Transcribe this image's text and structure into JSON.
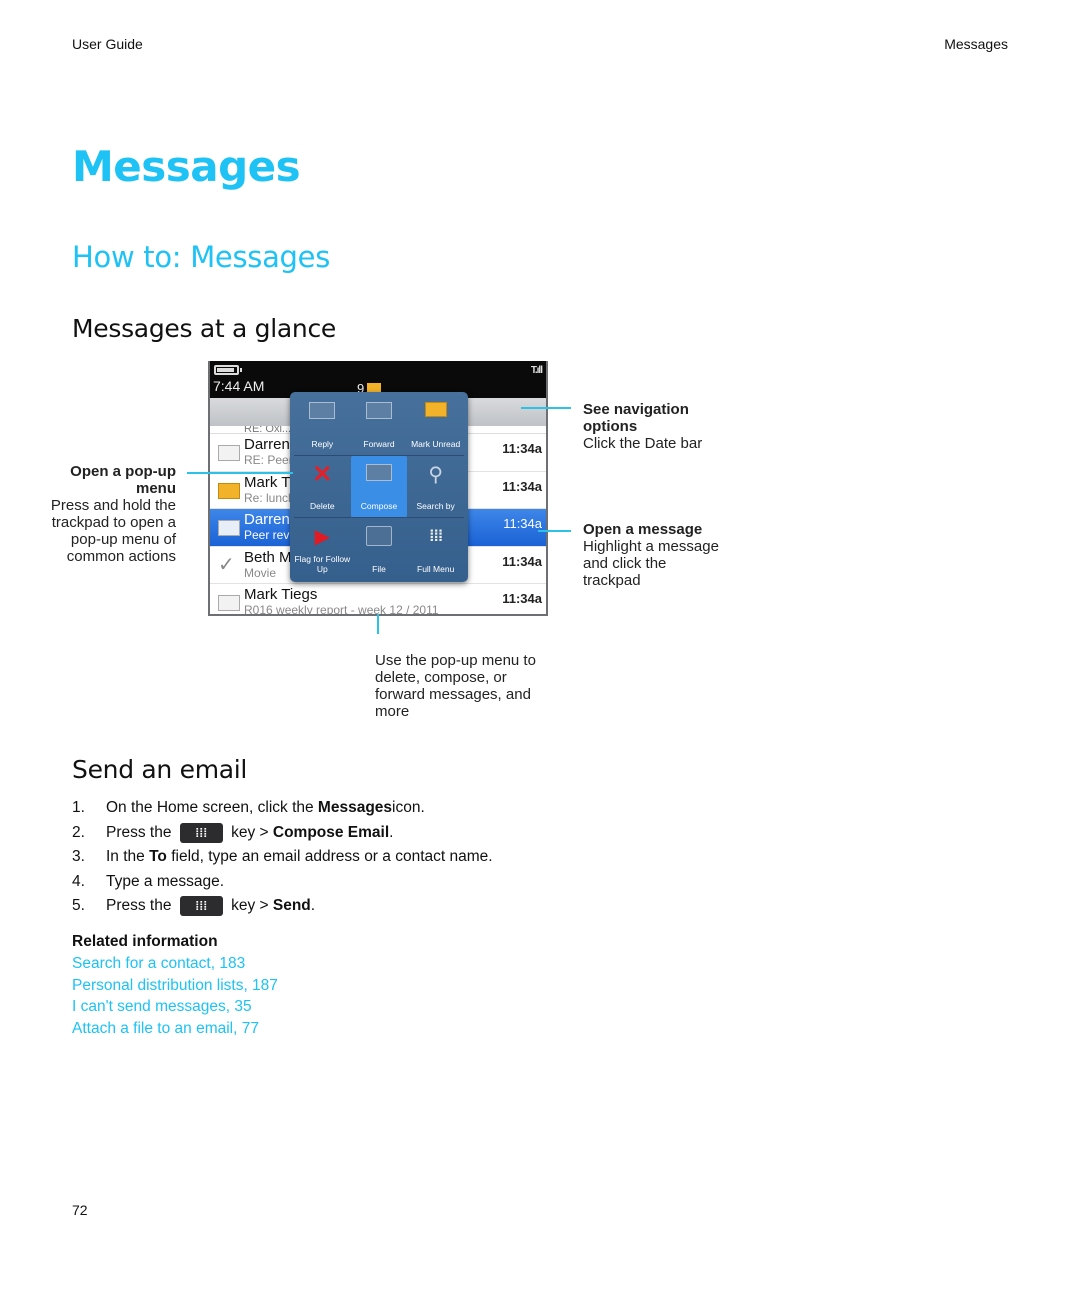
{
  "header": {
    "left": "User Guide",
    "right": "Messages"
  },
  "title": "Messages",
  "subtitle": "How to: Messages",
  "section_glance": "Messages at a glance",
  "phone": {
    "clock": "7:44 AM",
    "message_count": "9",
    "signal": "T.ıll",
    "partial_row_text": "RE: Oxi...                     LUD Ma...",
    "rows": [
      {
        "name": "Darren",
        "subject": "RE: Peer",
        "time": "11:34a",
        "icon": "envelope-read"
      },
      {
        "name": "Mark T",
        "subject": "Re: lunch",
        "time": "11:34a",
        "icon": "envelope-unread"
      },
      {
        "name": "Darren",
        "subject": "Peer review",
        "time": "11:34a",
        "icon": "envelope-attachment",
        "selected": true
      },
      {
        "name": "Beth M",
        "subject": "Movie",
        "time": "11:34a",
        "icon": "checkmark"
      },
      {
        "name": "Mark Tiegs",
        "subject": "R016 weekly report - week 12 / 2011",
        "time": "11:34a",
        "icon": "envelope-read"
      }
    ],
    "popup_menu": [
      {
        "label": "Reply",
        "icon": "reply-icon"
      },
      {
        "label": "Forward",
        "icon": "forward-icon"
      },
      {
        "label": "Mark Unread",
        "icon": "mark-unread-icon"
      },
      {
        "label": "Delete",
        "icon": "delete-icon"
      },
      {
        "label": "Compose",
        "icon": "compose-icon",
        "active": true
      },
      {
        "label": "Search by",
        "icon": "search-icon"
      },
      {
        "label": "Flag for Follow Up",
        "icon": "flag-icon"
      },
      {
        "label": "File",
        "icon": "folder-icon"
      },
      {
        "label": "Full Menu",
        "icon": "blackberry-icon"
      }
    ]
  },
  "callouts": {
    "left": {
      "title": "Open a pop-up menu",
      "body": "Press and hold the trackpad to open a pop-up menu of common actions"
    },
    "nav": {
      "title": "See navigation options",
      "body": "Click the Date bar"
    },
    "open": {
      "title": "Open a message",
      "body": "Highlight a message and click the trackpad"
    },
    "bottom": {
      "body": "Use the pop-up menu to delete, compose, or forward messages, and more"
    }
  },
  "section_send": "Send an email",
  "steps": [
    {
      "num": "1.",
      "pre": "On the Home screen, click the ",
      "bold": "Messages",
      "post": " icon."
    },
    {
      "num": "2.",
      "pre": "Press the ",
      "key": true,
      "mid": " key > ",
      "bold": "Compose Email",
      "post": "."
    },
    {
      "num": "3.",
      "pre": "In the ",
      "bold": "To",
      "post": " field, type an email address or a contact name."
    },
    {
      "num": "4.",
      "pre": "Type a message.",
      "bold": "",
      "post": ""
    },
    {
      "num": "5.",
      "pre": "Press the ",
      "key": true,
      "mid": " key > ",
      "bold": "Send",
      "post": "."
    }
  ],
  "related": {
    "title": "Related information",
    "links": [
      "Search for a contact, 183",
      "Personal distribution lists, 187",
      "I can't send messages, 35",
      "Attach a file to an email, 77"
    ]
  },
  "page_number": "72",
  "colors": {
    "accent": "#1ec2f4",
    "callout_line": "#2cc2e8",
    "selected_row": "#2a72e0"
  }
}
